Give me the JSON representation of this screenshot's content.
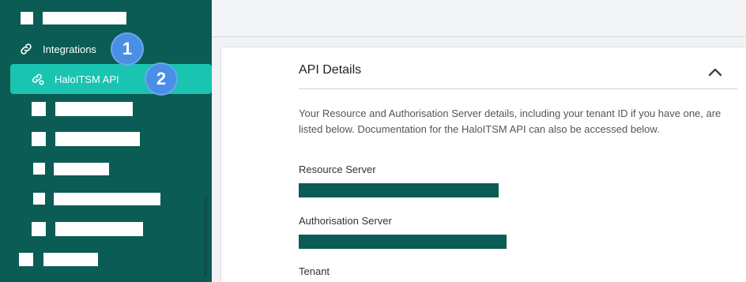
{
  "sidebar": {
    "integrations_label": "Integrations",
    "active_item_label": "HaloITSM API"
  },
  "badges": [
    "1",
    "2"
  ],
  "section": {
    "title": "API Details",
    "description": "Your Resource and Authorisation Server details, including your tenant ID if you have one, are listed below. Documentation for the HaloITSM API can also be accessed below."
  },
  "fields": {
    "resource_server_label": "Resource Server",
    "authorisation_server_label": "Authorisation Server",
    "tenant_label": "Tenant"
  },
  "colors": {
    "sidebar_bg": "#0b5c54",
    "active_item_bg": "#19c4b0",
    "badge_bg": "#4a8fe6",
    "redaction_bar": "#0b5c54"
  },
  "icons": {
    "integrations": "link-icon",
    "active_item": "api-link-icon",
    "collapse": "chevron-up-icon"
  }
}
